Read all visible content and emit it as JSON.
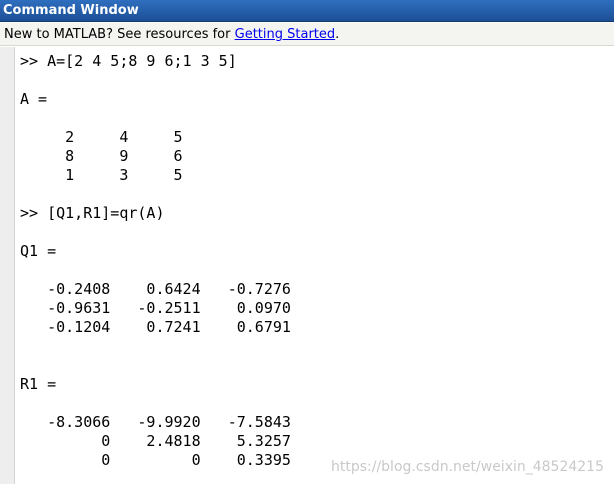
{
  "window": {
    "title": "Command Window"
  },
  "info_bar": {
    "text_prefix": "New to MATLAB? See resources for ",
    "link_text": "Getting Started",
    "text_suffix": "."
  },
  "console": {
    "lines": [
      ">> A=[2 4 5;8 9 6;1 3 5]",
      "",
      "A =",
      "",
      "     2     4     5",
      "     8     9     6",
      "     1     3     5",
      "",
      ">> [Q1,R1]=qr(A)",
      "",
      "Q1 =",
      "",
      "   -0.2408    0.6424   -0.7276",
      "   -0.9631   -0.2511    0.0970",
      "   -0.1204    0.7241    0.6791",
      "",
      "",
      "R1 =",
      "",
      "   -8.3066   -9.9920   -7.5843",
      "         0    2.4818    5.3257",
      "         0         0    0.3395"
    ]
  },
  "watermark": "https://blog.csdn.net/weixin_48524215"
}
